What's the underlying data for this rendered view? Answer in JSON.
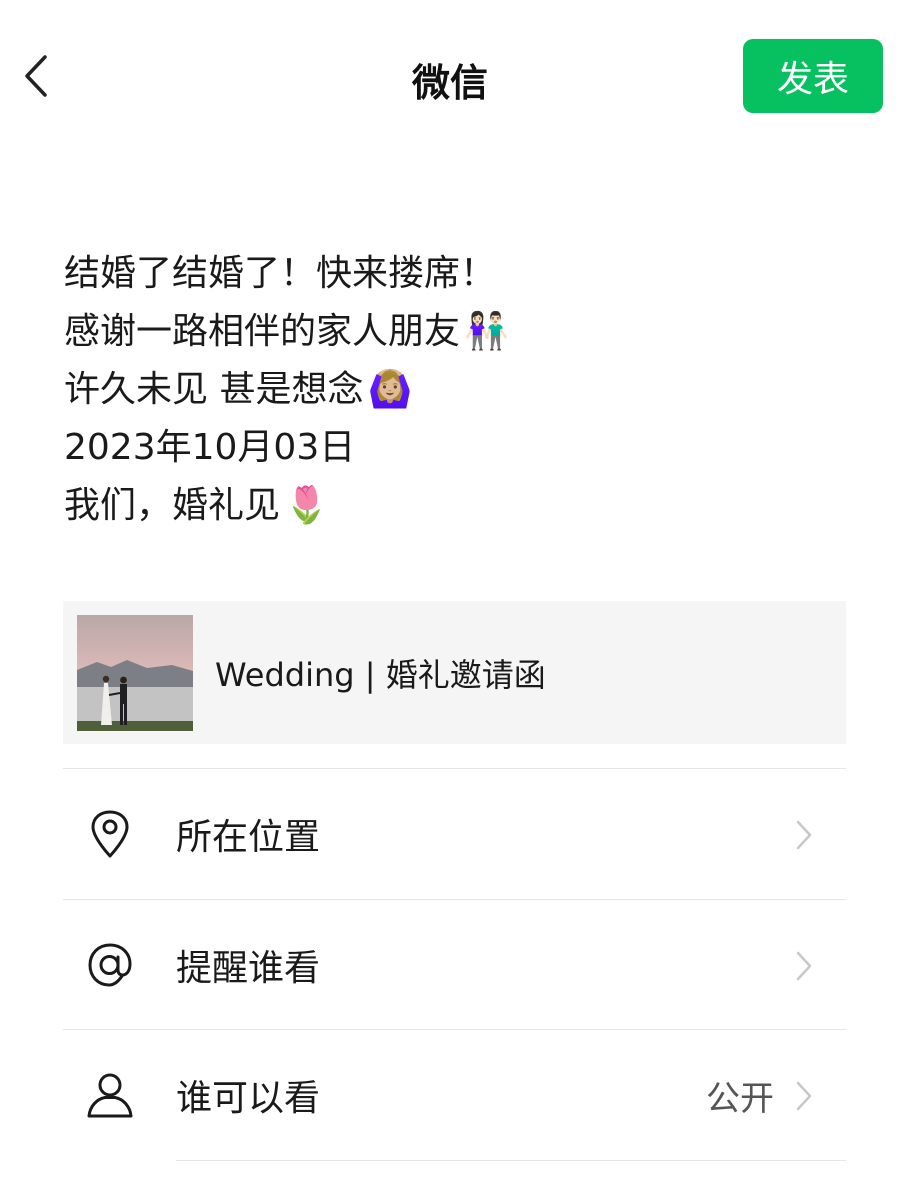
{
  "header": {
    "title": "微信",
    "publish_label": "发表",
    "back_icon": "chevron-left-icon"
  },
  "post": {
    "lines": [
      {
        "text": "结婚了结婚了！快来搂席！",
        "emoji": ""
      },
      {
        "text": "感谢一路相伴的家人朋友",
        "emoji": "👫🏻"
      },
      {
        "text": "许久未见 甚是想念",
        "emoji": "🙆🏼‍♀️"
      },
      {
        "text": "2023年10月03日",
        "emoji": ""
      },
      {
        "text": "我们，婚礼见",
        "emoji": "🌷"
      }
    ]
  },
  "link_card": {
    "title": "Wedding | 婚礼邀请函",
    "thumbnail": "wedding-photo-thumbnail"
  },
  "settings": [
    {
      "label": "所在位置",
      "value": "",
      "icon": "location-pin-icon"
    },
    {
      "label": "提醒谁看",
      "value": "",
      "icon": "at-sign-icon"
    },
    {
      "label": "谁可以看",
      "value": "公开",
      "icon": "person-icon"
    }
  ],
  "colors": {
    "accent": "#07c160",
    "card_bg": "#f5f5f5",
    "divider": "#e6e6e6"
  }
}
